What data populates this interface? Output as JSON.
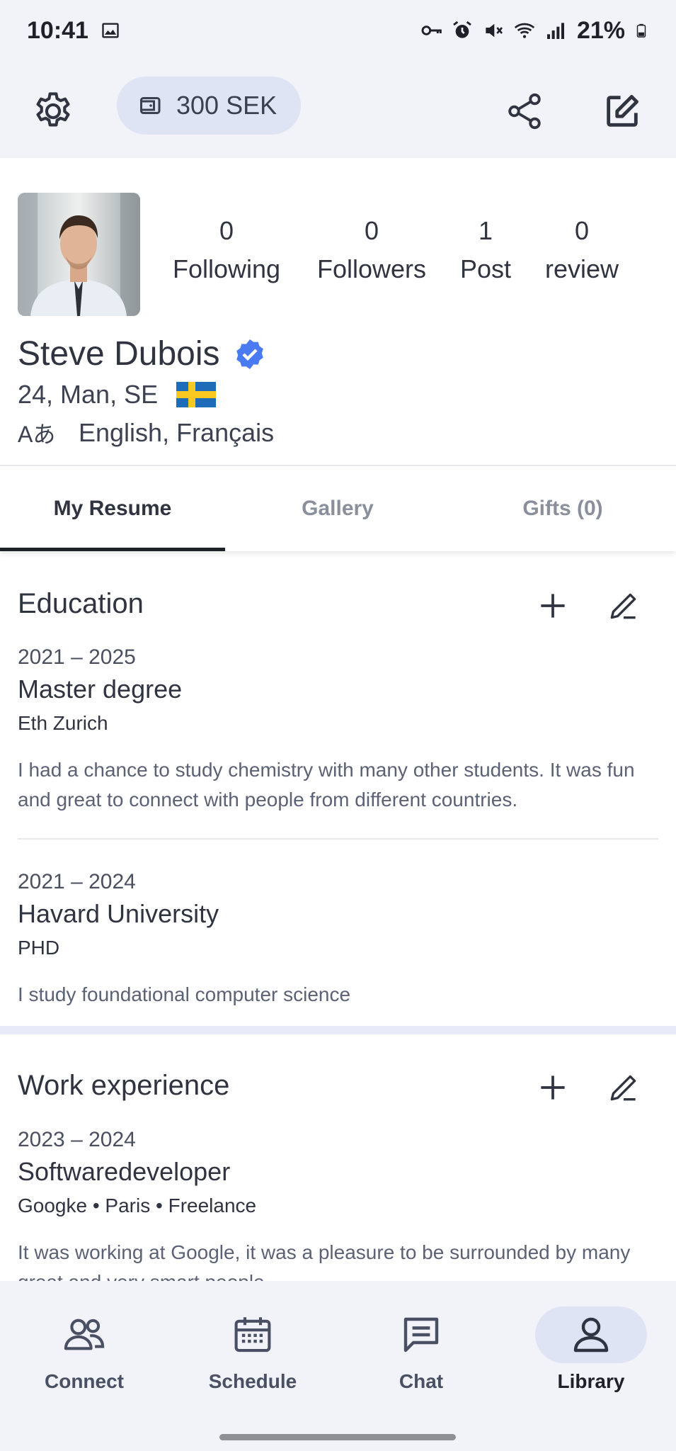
{
  "status_bar": {
    "time": "10:41",
    "battery": "21%",
    "icons": [
      "image-icon",
      "vpn-key-icon",
      "alarm-icon",
      "mute-icon",
      "wifi-icon",
      "signal-icon",
      "battery-icon"
    ]
  },
  "header": {
    "wallet_amount": "300  SEK",
    "icons": [
      "gear-icon",
      "wallet-icon",
      "share-icon",
      "edit-square-icon"
    ]
  },
  "profile": {
    "name": "Steve Dubois",
    "verified_icon": "verified-badge-icon",
    "meta": "24, Man, SE",
    "country_flag": "sweden-flag",
    "languages_icon": "Aあ",
    "languages": "English, Français",
    "stats": [
      {
        "value": "0",
        "label": "Following"
      },
      {
        "value": "0",
        "label": "Followers"
      },
      {
        "value": "1",
        "label": "Post"
      },
      {
        "value": "0",
        "label": "review"
      }
    ]
  },
  "tabs": [
    {
      "label": "My Resume",
      "active": true
    },
    {
      "label": "Gallery",
      "active": false
    },
    {
      "label": "Gifts (0)",
      "active": false
    }
  ],
  "education": {
    "title": "Education",
    "entries": [
      {
        "years": "2021 – 2025",
        "title": "Master degree",
        "subtitle": "Eth Zurich",
        "description": "I had a chance to study chemistry with many other students. It was fun and great to connect with people from different countries."
      },
      {
        "years": "2021 – 2024",
        "title": "Havard University",
        "subtitle": "PHD",
        "description": "I study foundational computer science"
      }
    ]
  },
  "work": {
    "title": "Work experience",
    "entries": [
      {
        "years": "2023 – 2024",
        "title": "Softwaredeveloper",
        "subtitle": "Googke • Paris • Freelance",
        "description": "It was working at Google, it was a pleasure to be surrounded by many great and very smart people"
      }
    ]
  },
  "bottom_nav": [
    {
      "label": "Connect",
      "icon": "people-icon",
      "active": false
    },
    {
      "label": "Schedule",
      "icon": "calendar-icon",
      "active": false
    },
    {
      "label": "Chat",
      "icon": "chat-icon",
      "active": false
    },
    {
      "label": "Library",
      "icon": "person-icon",
      "active": true
    }
  ],
  "colors": {
    "surface": "#f1f3f9",
    "pill": "#dfe4f5",
    "verified": "#4a7bf0",
    "text": "#2f3440"
  }
}
